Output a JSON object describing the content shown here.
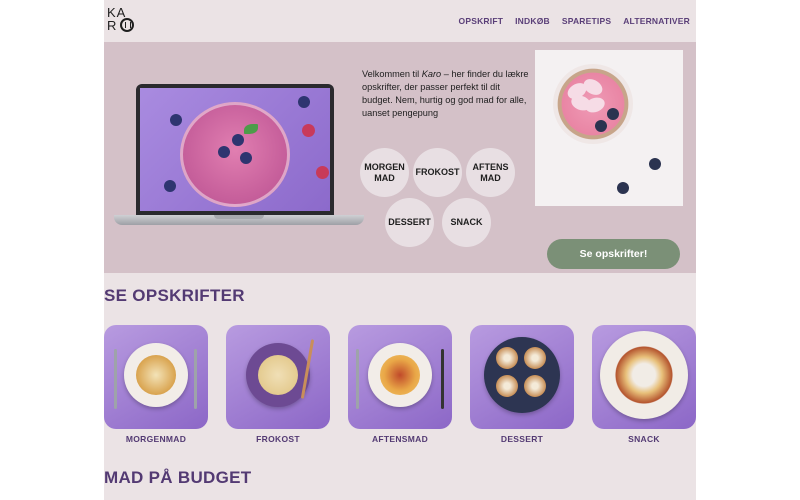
{
  "logo": {
    "line1": "KA",
    "line2": "R"
  },
  "nav": [
    "OPSKRIFT",
    "INDKØB",
    "SPARETIPS",
    "ALTERNATIVER"
  ],
  "hero": {
    "intro_before": "Velkommen til ",
    "intro_brand": "Karo",
    "intro_after": " – her finder du lækre opskrifter, der passer perfekt til dit budget. Nem, hurtig og god mad for alle, uanset pengepung",
    "categories": [
      "MORGEN MAD",
      "FROKOST",
      "AFTENS MAD",
      "DESSERT",
      "SNACK"
    ],
    "cta": "Se opskrifter!"
  },
  "recipes_title": "SE OPSKRIFTER",
  "recipes": [
    {
      "label": "MORGENMAD",
      "icon": "pancakes-dish-icon"
    },
    {
      "label": "FROKOST",
      "icon": "noodles-dish-icon"
    },
    {
      "label": "AFTENSMAD",
      "icon": "pasta-dish-icon"
    },
    {
      "label": "DESSERT",
      "icon": "cinnamon-rolls-icon"
    },
    {
      "label": "SNACK",
      "icon": "apple-slices-icon"
    }
  ],
  "budget_title": "MAD PÅ BUDGET",
  "colors": {
    "accent_purple": "#533a73",
    "hero_bg": "#d4c1c8",
    "page_bg": "#ebe3e5",
    "cta_green": "#7b9077"
  }
}
